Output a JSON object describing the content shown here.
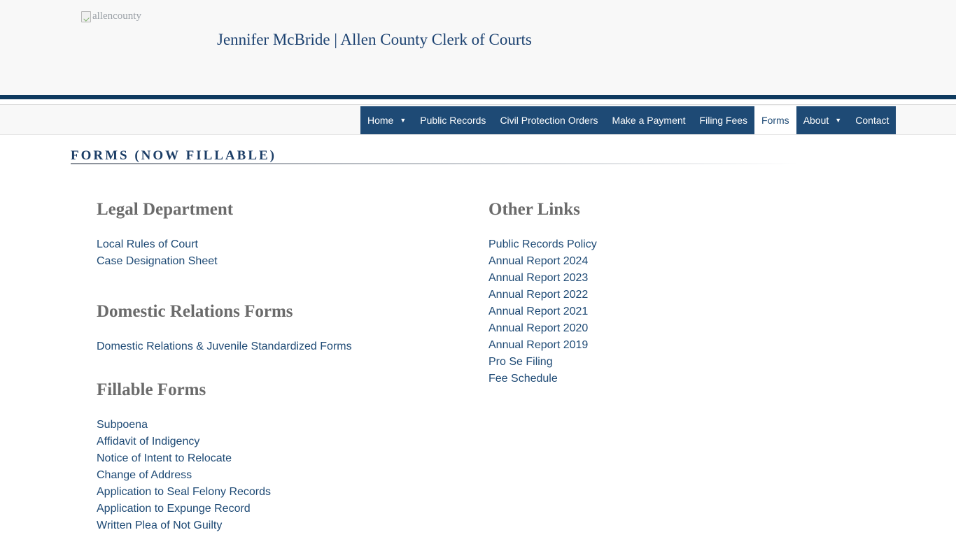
{
  "header": {
    "logo_alt": "allencounty",
    "title": "Jennifer McBride | Allen County Clerk of Courts"
  },
  "nav": {
    "items": [
      {
        "label": "Home",
        "dropdown": true
      },
      {
        "label": "Public Records"
      },
      {
        "label": "Civil Protection Orders"
      },
      {
        "label": "Make a Payment"
      },
      {
        "label": "Filing Fees"
      },
      {
        "label": "Forms",
        "active": true
      },
      {
        "label": "About",
        "dropdown": true
      },
      {
        "label": "Contact"
      }
    ],
    "caret": "▼"
  },
  "page": {
    "heading": "FORMS (NOW FILLABLE)"
  },
  "left": {
    "legal": {
      "title": "Legal Department",
      "links": [
        "Local Rules of Court",
        "Case Designation Sheet"
      ]
    },
    "domestic": {
      "title": "Domestic Relations Forms",
      "links": [
        "Domestic Relations & Juvenile Standardized Forms"
      ]
    },
    "fillable": {
      "title": "Fillable Forms",
      "links": [
        "Subpoena",
        "Affidavit of Indigency",
        "Notice of Intent to Relocate",
        "Change of Address",
        "Application to Seal Felony Records",
        "Application to Expunge Record",
        "Written Plea of Not Guilty"
      ]
    }
  },
  "right": {
    "other": {
      "title": "Other Links",
      "links": [
        "Public Records Policy",
        "Annual Report 2024",
        "Annual Report 2023",
        "Annual Report 2022",
        "Annual Report 2021",
        "Annual Report 2020",
        "Annual Report 2019",
        "Pro Se Filing",
        "Fee Schedule"
      ]
    }
  },
  "colors": {
    "brand_blue": "#1e4a75",
    "header_bar": "#0e3a5f",
    "section_title_gray": "#6b6b6b"
  }
}
